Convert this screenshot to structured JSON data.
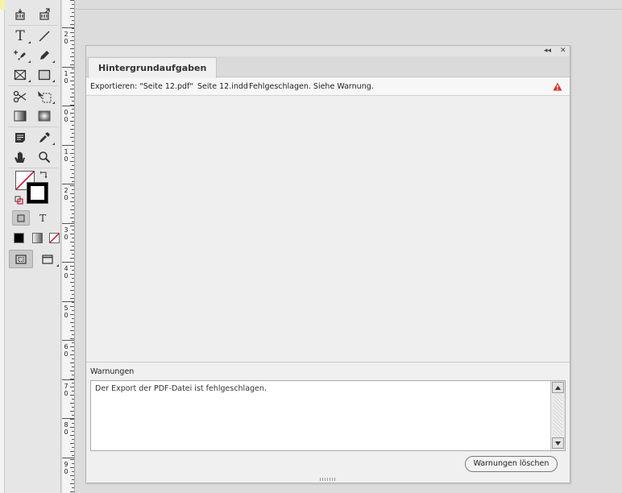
{
  "panel": {
    "tab_label": "Hintergrundaufgaben",
    "collapse_glyph": "◂◂",
    "close_glyph": "✕",
    "task": {
      "action": "Exportieren: \"Seite 12.pdf\"",
      "document": "Seite 12.indd",
      "status": "Fehlgeschlagen. Siehe Warnung."
    },
    "warnings_label": "Warnungen",
    "warning_message": "Der Export der PDF-Datei ist fehlgeschlagen.",
    "clear_button_label": "Warnungen löschen"
  },
  "ruler": {
    "labels": [
      "2",
      "1",
      "0",
      "1",
      "2",
      "3",
      "4",
      "5",
      "6",
      "7",
      "8",
      "9"
    ]
  },
  "tools": {
    "type_glyph": "T",
    "small_type_glyph": "T"
  },
  "colors": {
    "warning_red": "#d9322b",
    "stroke_red": "#c8102e"
  }
}
